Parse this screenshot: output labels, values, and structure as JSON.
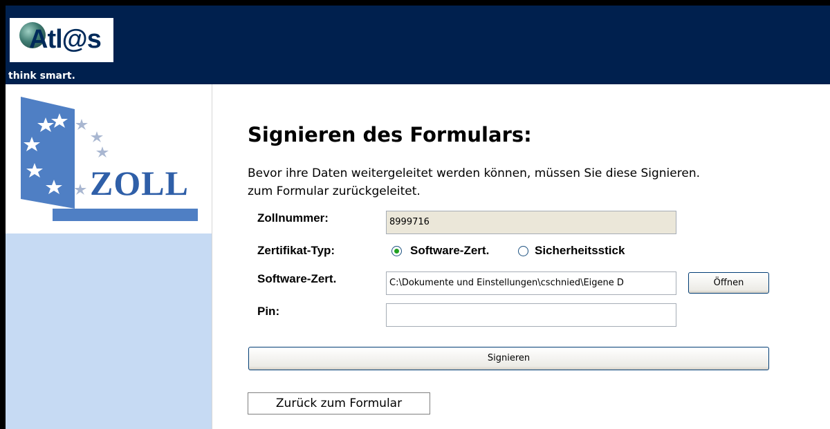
{
  "header": {
    "logo_text": "Atl@s",
    "tagline": "think smart."
  },
  "sidebar": {
    "emblem_text": "ZOLL"
  },
  "main": {
    "heading": "Signieren des Formulars:",
    "intro_line1": "Bevor ihre Daten weitergeleitet werden können, müssen Sie diese Signieren.",
    "intro_line2": "zum Formular zurückgeleitet."
  },
  "form": {
    "zollnummer_label": "Zollnummer:",
    "zollnummer_value": "8999716",
    "zertifikat_typ_label": "Zertifikat-Typ:",
    "radio_software_label": "Software-Zert.",
    "radio_stick_label": "Sicherheitsstick",
    "selected_type": "Software-Zert.",
    "software_zert_label": "Software-Zert.",
    "software_zert_value": "C:\\Dokumente und Einstellungen\\cschnied\\Eigene D",
    "oeffnen_label": "Öffnen",
    "pin_label": "Pin:",
    "pin_value": "",
    "signieren_label": "Signieren",
    "zurueck_label": "Zurück zum Formular"
  },
  "colors": {
    "header_bg": "#00204e",
    "sidebar_bg": "#c6daf3",
    "radio_selected": "#21a121",
    "zoll_blue": "#2f5fa8"
  }
}
